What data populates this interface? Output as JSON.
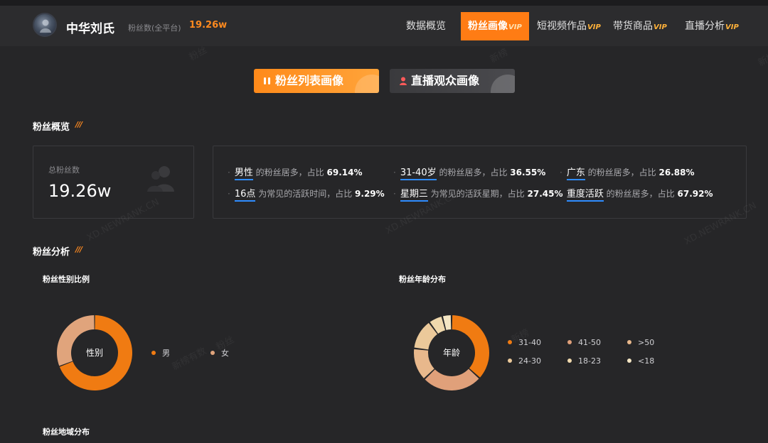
{
  "header": {
    "account_name": "中华刘氏",
    "fans_label": "粉丝数(全平台)",
    "fans_value": "19.26w",
    "nav": [
      {
        "label": "数据概览",
        "vip": ""
      },
      {
        "label": "粉丝画像",
        "vip": "VIP"
      },
      {
        "label": "短视频作品",
        "vip": "VIP"
      },
      {
        "label": "带货商品",
        "vip": "VIP"
      },
      {
        "label": "直播分析",
        "vip": "VIP"
      }
    ]
  },
  "tabs": {
    "fans_list": "粉丝列表画像",
    "live_audience": "直播观众画像"
  },
  "overview": {
    "title": "粉丝概览",
    "total_label": "总粉丝数",
    "total_value": "19.26w",
    "stats": [
      {
        "key": "男性",
        "text": "的粉丝居多，占比",
        "pct": "69.14%"
      },
      {
        "key": "31-40岁",
        "text": "的粉丝居多，占比",
        "pct": "36.55%"
      },
      {
        "key": "广东",
        "text": "的粉丝居多，占比",
        "pct": "26.88%"
      },
      {
        "key": "16点",
        "text": "为常见的活跃时间，占比",
        "pct": "9.29%"
      },
      {
        "key": "星期三",
        "text": "为常见的活跃星期，占比",
        "pct": "27.45%"
      },
      {
        "key": "重度活跃",
        "text": "的粉丝居多，占比",
        "pct": "67.92%"
      }
    ]
  },
  "analysis": {
    "title": "粉丝分析",
    "gender_title": "粉丝性别比例",
    "gender_center": "性别",
    "age_title": "粉丝年龄分布",
    "age_center": "年龄",
    "region_title": "粉丝地域分布"
  },
  "watermarks": [
    "XD.NEWRANK.CN",
    "新榜",
    "新榜有数",
    "粉丝"
  ],
  "colors": {
    "accent": "#ff7c14",
    "link_underline": "#2f8cff"
  },
  "chart_data": [
    {
      "type": "pie",
      "categories": [
        "男",
        "女"
      ],
      "values": [
        69.14,
        30.86
      ],
      "colors": [
        "#f07b12",
        "#e0a47c"
      ]
    },
    {
      "type": "pie",
      "categories": [
        "31-40",
        "41-50",
        ">50",
        "24-30",
        "18-23",
        "<18"
      ],
      "values": [
        36.55,
        26,
        14,
        13,
        6,
        4
      ],
      "colors": [
        "#f07b12",
        "#e0a07a",
        "#e8b88c",
        "#ebc99a",
        "#f0d9ad",
        "#f4e6c4"
      ]
    }
  ]
}
